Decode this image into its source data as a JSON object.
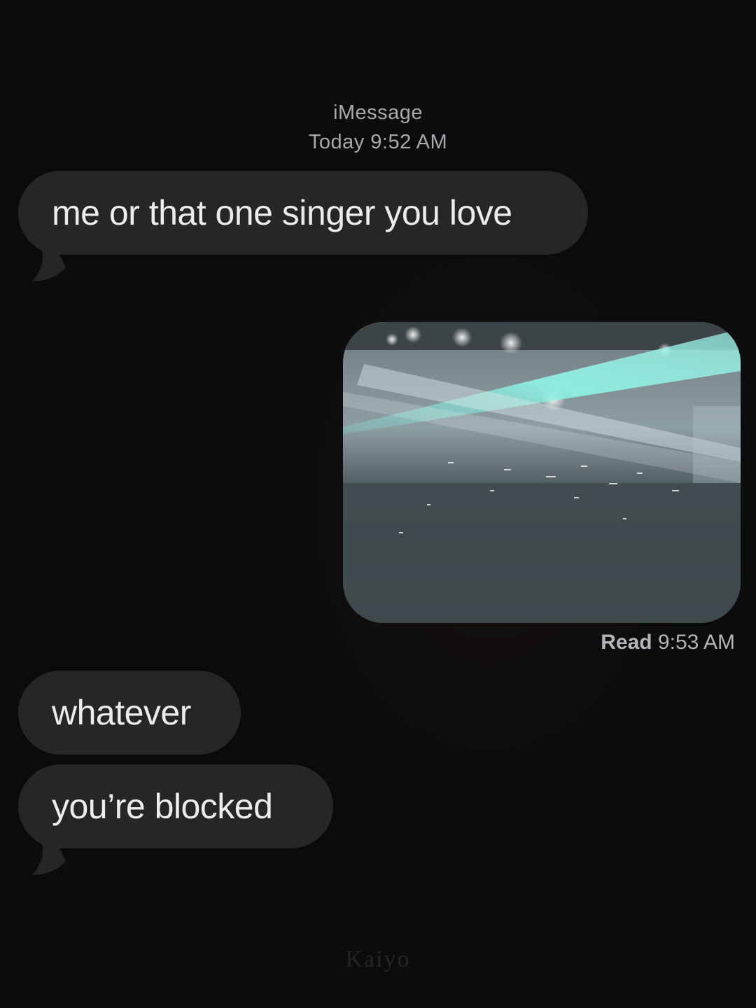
{
  "conversation": {
    "service_label": "iMessage",
    "timestamp": "Today 9:52 AM"
  },
  "messages": [
    {
      "direction": "incoming",
      "text": "me or that one singer you love"
    },
    {
      "direction": "outgoing",
      "type": "photo",
      "alt": "concert stage photo"
    },
    {
      "direction": "incoming",
      "text": "whatever"
    },
    {
      "direction": "incoming",
      "text": "you’re blocked"
    }
  ],
  "receipt": {
    "status": "Read",
    "time": "9:53 AM"
  },
  "watermark": "Kaiyo",
  "colors": {
    "background": "#0d0c0d",
    "incoming_bubble": "#262628",
    "bubble_text": "#ececee",
    "meta_text": "#a9a9ad"
  }
}
